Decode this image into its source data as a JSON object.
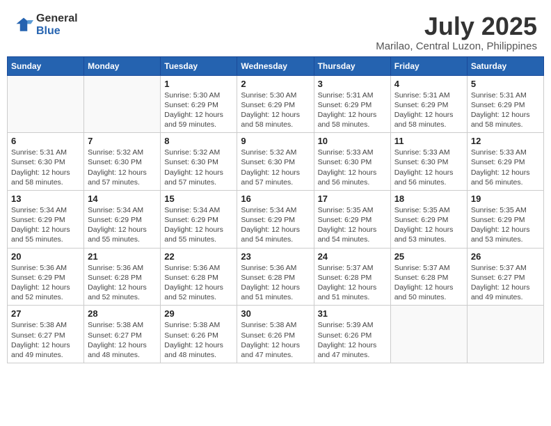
{
  "header": {
    "logo_general": "General",
    "logo_blue": "Blue",
    "month_title": "July 2025",
    "location": "Marilao, Central Luzon, Philippines"
  },
  "weekdays": [
    "Sunday",
    "Monday",
    "Tuesday",
    "Wednesday",
    "Thursday",
    "Friday",
    "Saturday"
  ],
  "weeks": [
    [
      {
        "day": "",
        "info": ""
      },
      {
        "day": "",
        "info": ""
      },
      {
        "day": "1",
        "info": "Sunrise: 5:30 AM\nSunset: 6:29 PM\nDaylight: 12 hours\nand 59 minutes."
      },
      {
        "day": "2",
        "info": "Sunrise: 5:30 AM\nSunset: 6:29 PM\nDaylight: 12 hours\nand 58 minutes."
      },
      {
        "day": "3",
        "info": "Sunrise: 5:31 AM\nSunset: 6:29 PM\nDaylight: 12 hours\nand 58 minutes."
      },
      {
        "day": "4",
        "info": "Sunrise: 5:31 AM\nSunset: 6:29 PM\nDaylight: 12 hours\nand 58 minutes."
      },
      {
        "day": "5",
        "info": "Sunrise: 5:31 AM\nSunset: 6:29 PM\nDaylight: 12 hours\nand 58 minutes."
      }
    ],
    [
      {
        "day": "6",
        "info": "Sunrise: 5:31 AM\nSunset: 6:30 PM\nDaylight: 12 hours\nand 58 minutes."
      },
      {
        "day": "7",
        "info": "Sunrise: 5:32 AM\nSunset: 6:30 PM\nDaylight: 12 hours\nand 57 minutes."
      },
      {
        "day": "8",
        "info": "Sunrise: 5:32 AM\nSunset: 6:30 PM\nDaylight: 12 hours\nand 57 minutes."
      },
      {
        "day": "9",
        "info": "Sunrise: 5:32 AM\nSunset: 6:30 PM\nDaylight: 12 hours\nand 57 minutes."
      },
      {
        "day": "10",
        "info": "Sunrise: 5:33 AM\nSunset: 6:30 PM\nDaylight: 12 hours\nand 56 minutes."
      },
      {
        "day": "11",
        "info": "Sunrise: 5:33 AM\nSunset: 6:30 PM\nDaylight: 12 hours\nand 56 minutes."
      },
      {
        "day": "12",
        "info": "Sunrise: 5:33 AM\nSunset: 6:29 PM\nDaylight: 12 hours\nand 56 minutes."
      }
    ],
    [
      {
        "day": "13",
        "info": "Sunrise: 5:34 AM\nSunset: 6:29 PM\nDaylight: 12 hours\nand 55 minutes."
      },
      {
        "day": "14",
        "info": "Sunrise: 5:34 AM\nSunset: 6:29 PM\nDaylight: 12 hours\nand 55 minutes."
      },
      {
        "day": "15",
        "info": "Sunrise: 5:34 AM\nSunset: 6:29 PM\nDaylight: 12 hours\nand 55 minutes."
      },
      {
        "day": "16",
        "info": "Sunrise: 5:34 AM\nSunset: 6:29 PM\nDaylight: 12 hours\nand 54 minutes."
      },
      {
        "day": "17",
        "info": "Sunrise: 5:35 AM\nSunset: 6:29 PM\nDaylight: 12 hours\nand 54 minutes."
      },
      {
        "day": "18",
        "info": "Sunrise: 5:35 AM\nSunset: 6:29 PM\nDaylight: 12 hours\nand 53 minutes."
      },
      {
        "day": "19",
        "info": "Sunrise: 5:35 AM\nSunset: 6:29 PM\nDaylight: 12 hours\nand 53 minutes."
      }
    ],
    [
      {
        "day": "20",
        "info": "Sunrise: 5:36 AM\nSunset: 6:29 PM\nDaylight: 12 hours\nand 52 minutes."
      },
      {
        "day": "21",
        "info": "Sunrise: 5:36 AM\nSunset: 6:28 PM\nDaylight: 12 hours\nand 52 minutes."
      },
      {
        "day": "22",
        "info": "Sunrise: 5:36 AM\nSunset: 6:28 PM\nDaylight: 12 hours\nand 52 minutes."
      },
      {
        "day": "23",
        "info": "Sunrise: 5:36 AM\nSunset: 6:28 PM\nDaylight: 12 hours\nand 51 minutes."
      },
      {
        "day": "24",
        "info": "Sunrise: 5:37 AM\nSunset: 6:28 PM\nDaylight: 12 hours\nand 51 minutes."
      },
      {
        "day": "25",
        "info": "Sunrise: 5:37 AM\nSunset: 6:28 PM\nDaylight: 12 hours\nand 50 minutes."
      },
      {
        "day": "26",
        "info": "Sunrise: 5:37 AM\nSunset: 6:27 PM\nDaylight: 12 hours\nand 49 minutes."
      }
    ],
    [
      {
        "day": "27",
        "info": "Sunrise: 5:38 AM\nSunset: 6:27 PM\nDaylight: 12 hours\nand 49 minutes."
      },
      {
        "day": "28",
        "info": "Sunrise: 5:38 AM\nSunset: 6:27 PM\nDaylight: 12 hours\nand 48 minutes."
      },
      {
        "day": "29",
        "info": "Sunrise: 5:38 AM\nSunset: 6:26 PM\nDaylight: 12 hours\nand 48 minutes."
      },
      {
        "day": "30",
        "info": "Sunrise: 5:38 AM\nSunset: 6:26 PM\nDaylight: 12 hours\nand 47 minutes."
      },
      {
        "day": "31",
        "info": "Sunrise: 5:39 AM\nSunset: 6:26 PM\nDaylight: 12 hours\nand 47 minutes."
      },
      {
        "day": "",
        "info": ""
      },
      {
        "day": "",
        "info": ""
      }
    ]
  ]
}
